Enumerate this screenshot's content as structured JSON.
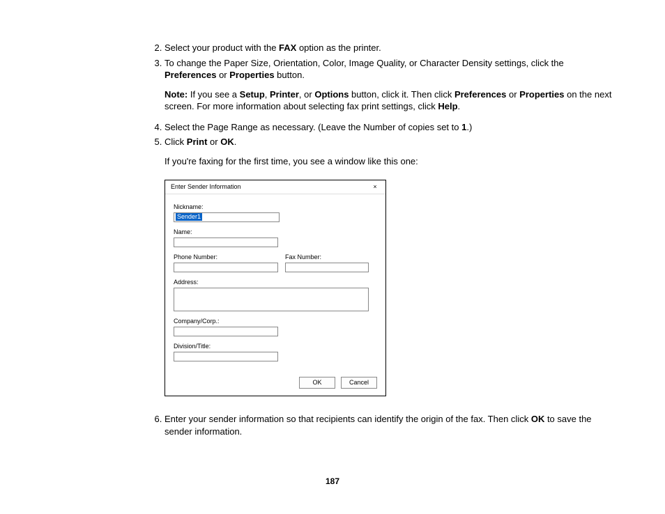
{
  "steps": {
    "s2": {
      "num": "2.",
      "pre": "Select your product with the ",
      "b1": "FAX",
      "post": " option as the printer."
    },
    "s3": {
      "num": "3.",
      "t1": "To change the Paper Size, Orientation, Color, Image Quality, or Character Density settings, click the ",
      "b1": "Preferences",
      "or1": " or ",
      "b2": "Properties",
      "t2": " button.",
      "note_label": "Note:",
      "note1": " If you see a ",
      "nb1": "Setup",
      "nc1": ", ",
      "nb2": "Printer",
      "nc2": ", or ",
      "nb3": "Options",
      "note2": " button, click it. Then click ",
      "nb4": "Preferences",
      "nc3": " or ",
      "nb5": "Properties",
      "note3": " on the next screen. For more information about selecting fax print settings, click ",
      "nb6": "Help",
      "note4": "."
    },
    "s4": {
      "num": "4.",
      "t1": "Select the Page Range as necessary. (Leave the Number of copies set to ",
      "b1": "1",
      "t2": ".)"
    },
    "s5": {
      "num": "5.",
      "t1": "Click ",
      "b1": "Print",
      "or": " or ",
      "b2": "OK",
      "t2": ".",
      "sub": "If you're faxing for the first time, you see a window like this one:"
    },
    "s6": {
      "num": "6.",
      "t1": "Enter your sender information so that recipients can identify the origin of the fax. Then click ",
      "b1": "OK",
      "t2": " to save the sender information."
    }
  },
  "dialog": {
    "title": "Enter Sender Information",
    "close": "×",
    "nickname_label": "Nickname:",
    "nickname_value": "Sender1",
    "name_label": "Name:",
    "phone_label": "Phone Number:",
    "fax_label": "Fax Number:",
    "address_label": "Address:",
    "company_label": "Company/Corp.:",
    "division_label": "Division/Title:",
    "ok": "OK",
    "cancel": "Cancel"
  },
  "page_number": "187"
}
